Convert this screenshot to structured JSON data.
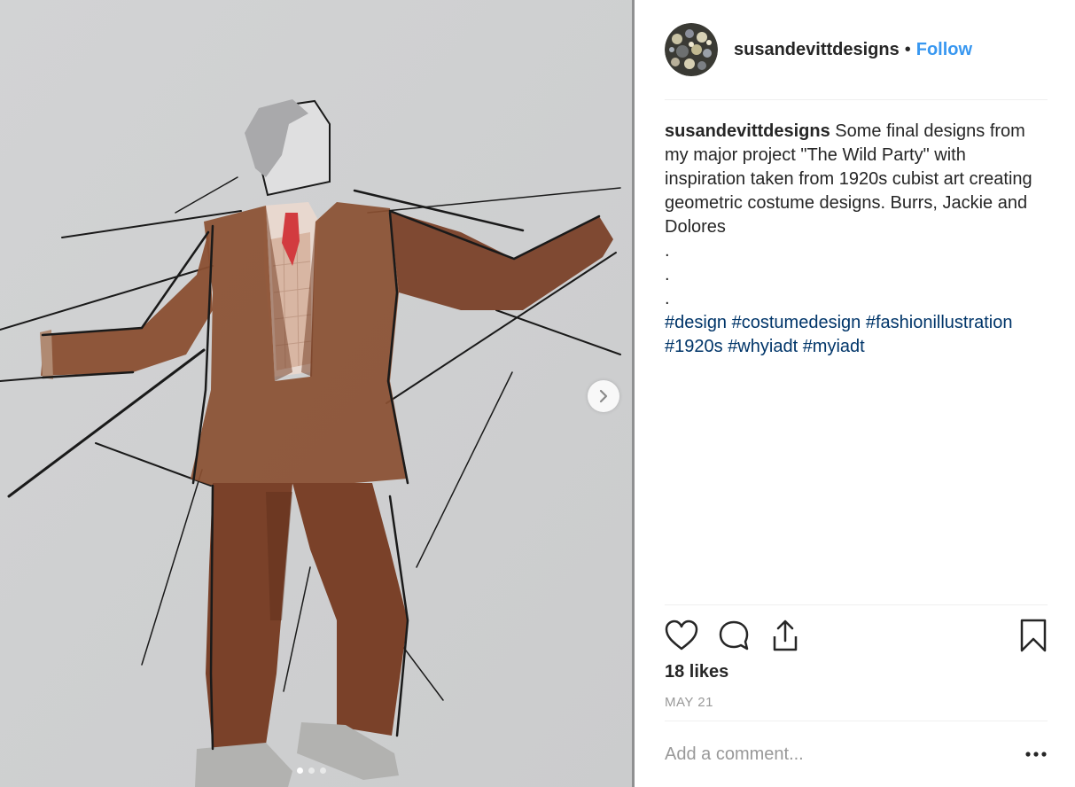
{
  "post": {
    "username": "susandevittdesigns",
    "separator": "•",
    "follow_label": "Follow",
    "caption": {
      "username": "susandevittdesigns",
      "text": "Some final designs from my major project \"The Wild Party\" with inspiration taken from 1920s cubist art creating geometric costume designs. Burrs, Jackie and Dolores",
      "dots": [
        ".",
        ".",
        "."
      ],
      "hashtags": [
        "#design",
        "#costumedesign",
        "#fashionillustration",
        "#1920s",
        "#whyiadt",
        "#myiadt"
      ]
    },
    "likes": "18 likes",
    "date": "MAY 21",
    "comment_placeholder": "Add a comment...",
    "carousel": {
      "count": 3,
      "active_index": 0
    }
  },
  "icons": {
    "like": "heart-outline-icon",
    "comment": "speech-bubble-icon",
    "share": "share-upload-icon",
    "save": "bookmark-icon",
    "more": "more-options-icon",
    "next": "chevron-right-icon"
  },
  "colors": {
    "link": "#3897f0",
    "hashtag": "#003569",
    "muted": "#999999",
    "text": "#262626",
    "suit": "#8a4f31",
    "tie": "#d23b3f"
  }
}
